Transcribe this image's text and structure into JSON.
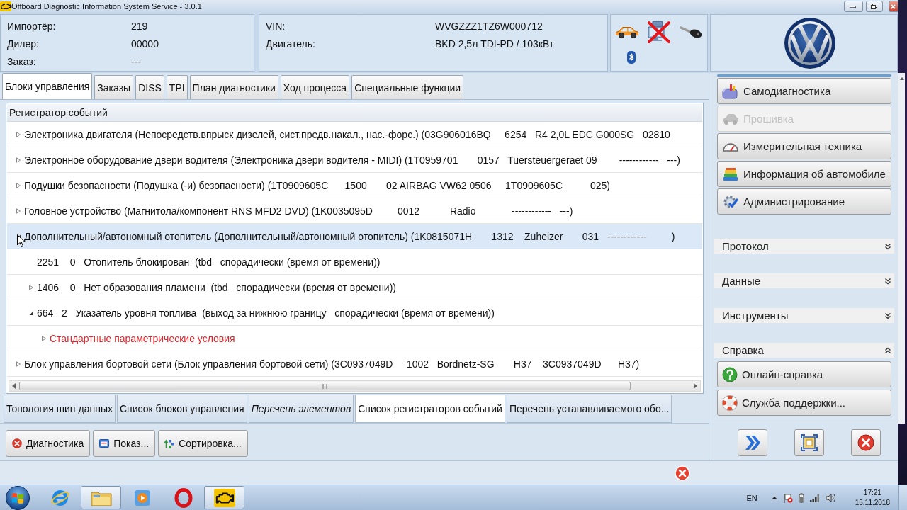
{
  "window": {
    "title": "Offboard Diagnostic Information System Service - 3.0.1"
  },
  "order_info": [
    {
      "label": "Импортёр:",
      "value": "219"
    },
    {
      "label": "Дилер:",
      "value": "00000"
    },
    {
      "label": "Заказ:",
      "value": "---"
    }
  ],
  "vehicle_info": [
    {
      "label": "VIN:",
      "value": "WVGZZZ1TZ6W000712"
    },
    {
      "label": "Двигатель:",
      "value": "BKD 2,5л TDI-PD / 103кВт"
    }
  ],
  "tabs": [
    {
      "label": "Блоки управления",
      "selected": true
    },
    {
      "label": "Заказы",
      "selected": false
    },
    {
      "label": "DISS",
      "selected": false
    },
    {
      "label": "TPI",
      "selected": false
    },
    {
      "label": "План диагностики",
      "selected": false
    },
    {
      "label": "Ход процесса",
      "selected": false
    },
    {
      "label": "Специальные функции",
      "selected": false
    }
  ],
  "event_log": {
    "title": "Регистратор событий",
    "items": [
      {
        "text": "Электроника двигателя (Непосредств.впрыск дизелей, сист.предв.накал., нас.-форс.) (03G906016BQ     6254   R4 2,0L EDC G000SG   02810",
        "expanded": false,
        "selected": false
      },
      {
        "text": "Электронное оборудование двери водителя (Электроника двери водителя - MIDI) (1T0959701       0157   Tuersteuergeraet 09        ------------   ---)",
        "expanded": false,
        "selected": false
      },
      {
        "text": "Подушки безопасности (Подушка (-и) безопасности) (1T0909605C      1500       02 AIRBAG VW62 0506     1T0909605C          025)",
        "expanded": false,
        "selected": false
      },
      {
        "text": "Головное устройство (Магнитола/компонент RNS MFD2 DVD) (1K0035095D         0012           Radio             ------------   ---)",
        "expanded": false,
        "selected": false
      },
      {
        "text": "Дополнительный/автономный отопитель (Дополнительный/автономный отопитель) (1K0815071H       1312    Zuheizer       031   ------------         )",
        "expanded": true,
        "selected": true,
        "children": [
          {
            "text": "2251    0   Отопитель блокирован  (tbd   спорадически (время от времени))",
            "selected": false
          },
          {
            "text": "1406    0   Нет образования пламени  (tbd   спорадически (время от времени))",
            "expanded": false,
            "selected": false
          },
          {
            "text": "664   2   Указатель уровня топлива  (выход за нижнюю границу   спорадически (время от времени))",
            "expanded": true,
            "selected": false,
            "children": [
              {
                "kind": "conditions",
                "text": "Стандартные параметрические условия",
                "expanded": false,
                "selected": false
              }
            ]
          }
        ]
      },
      {
        "text": "Блок управления бортовой сети (Блок управления бортовой сети) (3C0937049D     1002   Bordnetz-SG       H37    3C0937049D      H37)",
        "expanded": false,
        "selected": false
      }
    ]
  },
  "view_tabs": [
    {
      "label": "Топология шин данных",
      "selected": false,
      "unavailable": false
    },
    {
      "label": "Список блоков управления",
      "selected": false,
      "unavailable": false
    },
    {
      "label": "Перечень элементов",
      "selected": false,
      "unavailable": true
    },
    {
      "label": "Список регистраторов событий",
      "selected": true,
      "unavailable": false
    },
    {
      "label": "Перечень устанавливаемого обо...",
      "selected": false,
      "unavailable": false
    }
  ],
  "actions": [
    {
      "kind": "stop",
      "label": "Диагностика"
    },
    {
      "kind": "view",
      "label": "Показ..."
    },
    {
      "kind": "sort",
      "label": "Сортировка..."
    }
  ],
  "sidebar": {
    "buttons": [
      {
        "kind": "selftest",
        "label": "Самодиагностика",
        "disabled": false
      },
      {
        "kind": "flash",
        "label": "Прошивка",
        "disabled": true
      },
      {
        "kind": "measure",
        "label": "Измерительная техника",
        "disabled": false
      },
      {
        "kind": "info",
        "label": "Информация об автомобиле",
        "disabled": false
      },
      {
        "kind": "admin",
        "label": "Администрирование",
        "disabled": false
      }
    ],
    "sections": [
      {
        "title": "Протокол",
        "expanded": false
      },
      {
        "title": "Данные",
        "expanded": false
      },
      {
        "title": "Инструменты",
        "expanded": false
      },
      {
        "title": "Справка",
        "expanded": true,
        "items": [
          {
            "kind": "help",
            "label": "Онлайн-справка"
          },
          {
            "kind": "support",
            "label": "Служба поддержки..."
          }
        ]
      }
    ]
  },
  "taskbar": {
    "apps": [
      {
        "running": false
      },
      {
        "running": true
      },
      {
        "running": false
      },
      {
        "running": false
      },
      {
        "running": true
      }
    ],
    "language": "EN",
    "time": "17:21",
    "date": "15.11.2018"
  }
}
